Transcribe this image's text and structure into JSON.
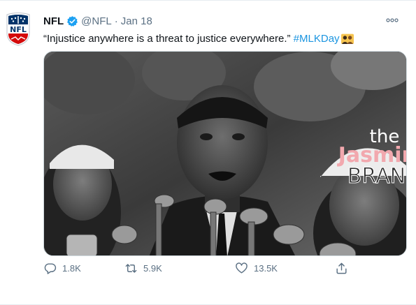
{
  "tweet": {
    "author_name": "NFL",
    "handle": "@NFL",
    "separator": "·",
    "date": "Jan 18",
    "text_quote": "“Injustice anywhere is a threat to justice everywhere.”",
    "hashtag": "#MLKDay",
    "avatar_logo_text": "NFL"
  },
  "media": {
    "watermark_line1": "the",
    "watermark_line2": "Jasmine",
    "watermark_line3": "BRAND"
  },
  "actions": {
    "reply_count": "1.8K",
    "retweet_count": "5.9K",
    "like_count": "13.5K"
  },
  "colors": {
    "accent": "#1b95e0",
    "muted": "#5b7083",
    "nfl_blue": "#013369",
    "nfl_red": "#d50a0a"
  },
  "icons": {
    "verified": "verified-badge-icon",
    "more": "more-options-icon",
    "reply": "reply-icon",
    "retweet": "retweet-icon",
    "like": "heart-icon",
    "share": "share-icon"
  }
}
